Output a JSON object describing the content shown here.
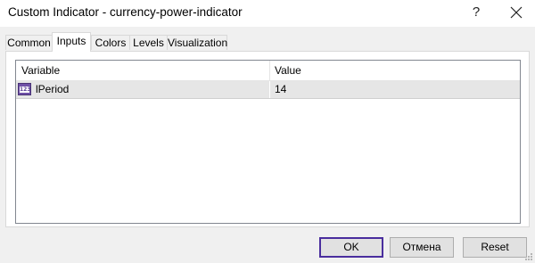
{
  "window": {
    "title": "Custom Indicator - currency-power-indicator",
    "help_label": "?"
  },
  "tabs": [
    {
      "label": "Common",
      "active": false
    },
    {
      "label": "Inputs",
      "active": true
    },
    {
      "label": "Colors",
      "active": false
    },
    {
      "label": "Levels",
      "active": false
    },
    {
      "label": "Visualization",
      "active": false
    }
  ],
  "grid": {
    "columns": [
      "Variable",
      "Value"
    ],
    "rows": [
      {
        "icon": "integer-type-icon",
        "icon_text": "123",
        "variable": "lPeriod",
        "value": "14"
      }
    ]
  },
  "buttons": {
    "ok": "OK",
    "cancel": "Отмена",
    "reset": "Reset"
  },
  "colors": {
    "accent": "#4a2e9e",
    "row_highlight": "#e6e6e6",
    "icon_purple": "#6f51a7"
  }
}
